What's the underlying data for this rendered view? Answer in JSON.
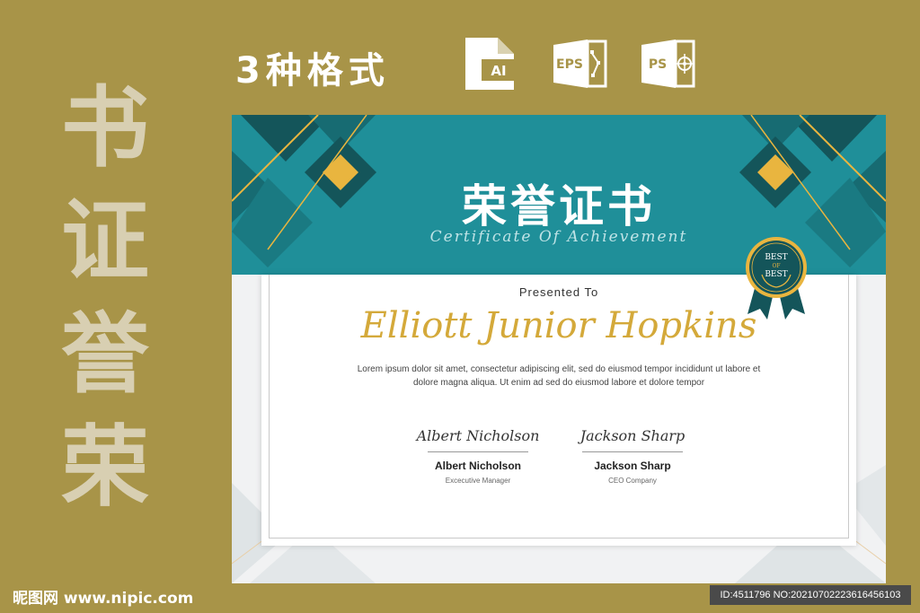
{
  "side_title": [
    "书",
    "证",
    "誉",
    "荣"
  ],
  "formats_heading": "3种格式",
  "format_icons": [
    {
      "icon": "ai-file-icon",
      "label": "AI"
    },
    {
      "icon": "eps-file-icon",
      "label": "EPS"
    },
    {
      "icon": "ps-file-icon",
      "label": "PS"
    }
  ],
  "certificate": {
    "title_cn": "荣誉证书",
    "title_en": "Certificate Of Achievement",
    "presented_to": "Presented To",
    "recipient": "Elliott Junior Hopkins",
    "body": "Lorem ipsum dolor sit amet, consectetur adipiscing elit, sed do eiusmod tempor incididunt ut labore et dolore magna aliqua. Ut enim ad sed do eiusmod labore et dolore  tempor",
    "badge": {
      "line1": "BEST",
      "line2": "OF",
      "line3": "BEST"
    },
    "signatures": [
      {
        "script": "Albert Nicholson",
        "name": "Albert Nicholson",
        "role": "Excecutive Manager"
      },
      {
        "script": "Jackson Sharp",
        "name": "Jackson Sharp",
        "role": "CEO Company"
      }
    ]
  },
  "watermark": {
    "site": "昵图网 www.nipic.com",
    "id": "ID:4511796 NO:20210702223616456103"
  },
  "colors": {
    "background": "#a89448",
    "teal": "#1f8f99",
    "dark_teal": "#14555a",
    "gold": "#e9b53f"
  }
}
